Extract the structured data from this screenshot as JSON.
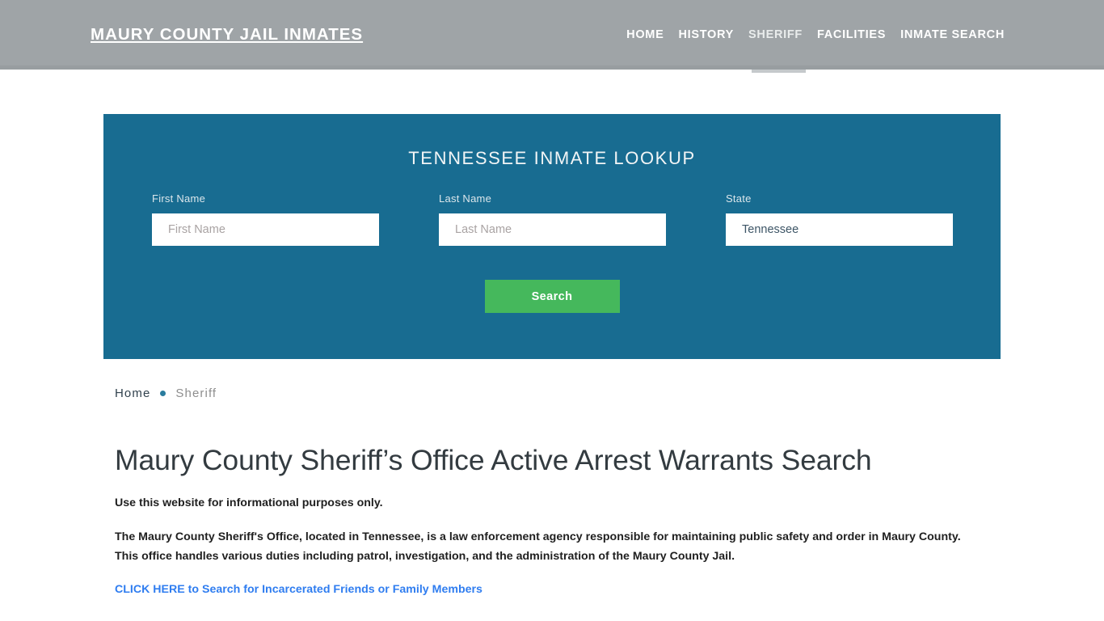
{
  "header": {
    "brand": "MAURY COUNTY JAIL INMATES",
    "nav": [
      {
        "label": "HOME",
        "active": false
      },
      {
        "label": "HISTORY",
        "active": false
      },
      {
        "label": "SHERIFF",
        "active": true
      },
      {
        "label": "FACILITIES",
        "active": false
      },
      {
        "label": "INMATE SEARCH",
        "active": false
      }
    ]
  },
  "lookup": {
    "title": "TENNESSEE INMATE LOOKUP",
    "fields": [
      {
        "label": "First Name",
        "placeholder": "First Name",
        "value": ""
      },
      {
        "label": "Last Name",
        "placeholder": "Last Name",
        "value": ""
      },
      {
        "label": "State",
        "placeholder": "State",
        "value": "Tennessee"
      }
    ],
    "submit_label": "Search"
  },
  "breadcrumb": {
    "home": "Home",
    "separator": "bullet-separator-icon",
    "current": "Sheriff"
  },
  "main": {
    "title": "Maury County Sheriff’s Office Active Arrest Warrants Search",
    "lead": "Use this website for informational purposes only.",
    "paragraph": "The Maury County Sheriff's Office, located in Tennessee, is a law enforcement agency responsible for maintaining public safety and order in Maury County. This office handles various duties including patrol, investigation, and the administration of the Maury County Jail.",
    "cta_link": "CLICK HERE to Search for Incarcerated Friends or Family Members"
  },
  "colors": {
    "header_bg": "#9fa4a7",
    "panel_bg": "#186c91",
    "button_bg": "#45b85c",
    "link": "#2f7df0",
    "breadcrumb_dot": "#2a7c9e"
  }
}
